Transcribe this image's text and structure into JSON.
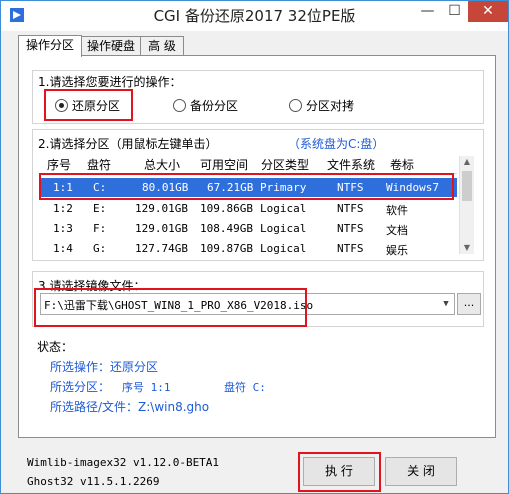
{
  "window": {
    "title": "CGI 备份还原2017 32位PE版",
    "min_glyph": "—",
    "max_glyph": "☐",
    "close_glyph": "✕"
  },
  "tabs": [
    "操作分区",
    "操作硬盘",
    "高 级"
  ],
  "operation": {
    "label": "1.请选择您要进行的操作：",
    "options": [
      {
        "label": "还原分区",
        "selected": true
      },
      {
        "label": "备份分区",
        "selected": false
      },
      {
        "label": "分区对拷",
        "selected": false
      }
    ]
  },
  "partition": {
    "label": "2.请选择分区（用鼠标左键单击）",
    "system_disk": "（系统盘为C:盘）",
    "columns": [
      "序号",
      "盘符",
      "总大小",
      "可用空间",
      "分区类型",
      "文件系统",
      "卷标"
    ],
    "rows": [
      [
        "1:1",
        "C:",
        "80.01GB",
        "67.21GB",
        "Primary",
        "NTFS",
        "Windows7"
      ],
      [
        "1:2",
        "E:",
        "129.01GB",
        "109.86GB",
        "Logical",
        "NTFS",
        "软件"
      ],
      [
        "1:3",
        "F:",
        "129.01GB",
        "108.49GB",
        "Logical",
        "NTFS",
        "文档"
      ],
      [
        "1:4",
        "G:",
        "127.74GB",
        "109.87GB",
        "Logical",
        "NTFS",
        "娱乐"
      ]
    ],
    "selected_row": 0
  },
  "image": {
    "label": "3.请选择镜像文件：",
    "value": "F:\\迅雷下载\\GHOST_WIN8_1_PRO_X86_V2018.iso",
    "browse_label": "..."
  },
  "status": {
    "label": "状态：",
    "op_label": "所选操作：还原分区",
    "part_label": "所选分区：",
    "part_no_label": "序号 1:1",
    "drive_label": "盘符 C:",
    "path_label": "所选路径/文件：Z:\\win8.gho"
  },
  "footer": {
    "wimlib": "Wimlib-imagex32 v1.12.0-BETA1",
    "ghost": "Ghost32 v11.5.1.2269",
    "execute_label": "执 行",
    "close_label": "关 闭"
  },
  "colors": {
    "accent": "#2f6fdc",
    "highlight": "#e0141e",
    "status_text": "#1e5bd6"
  }
}
